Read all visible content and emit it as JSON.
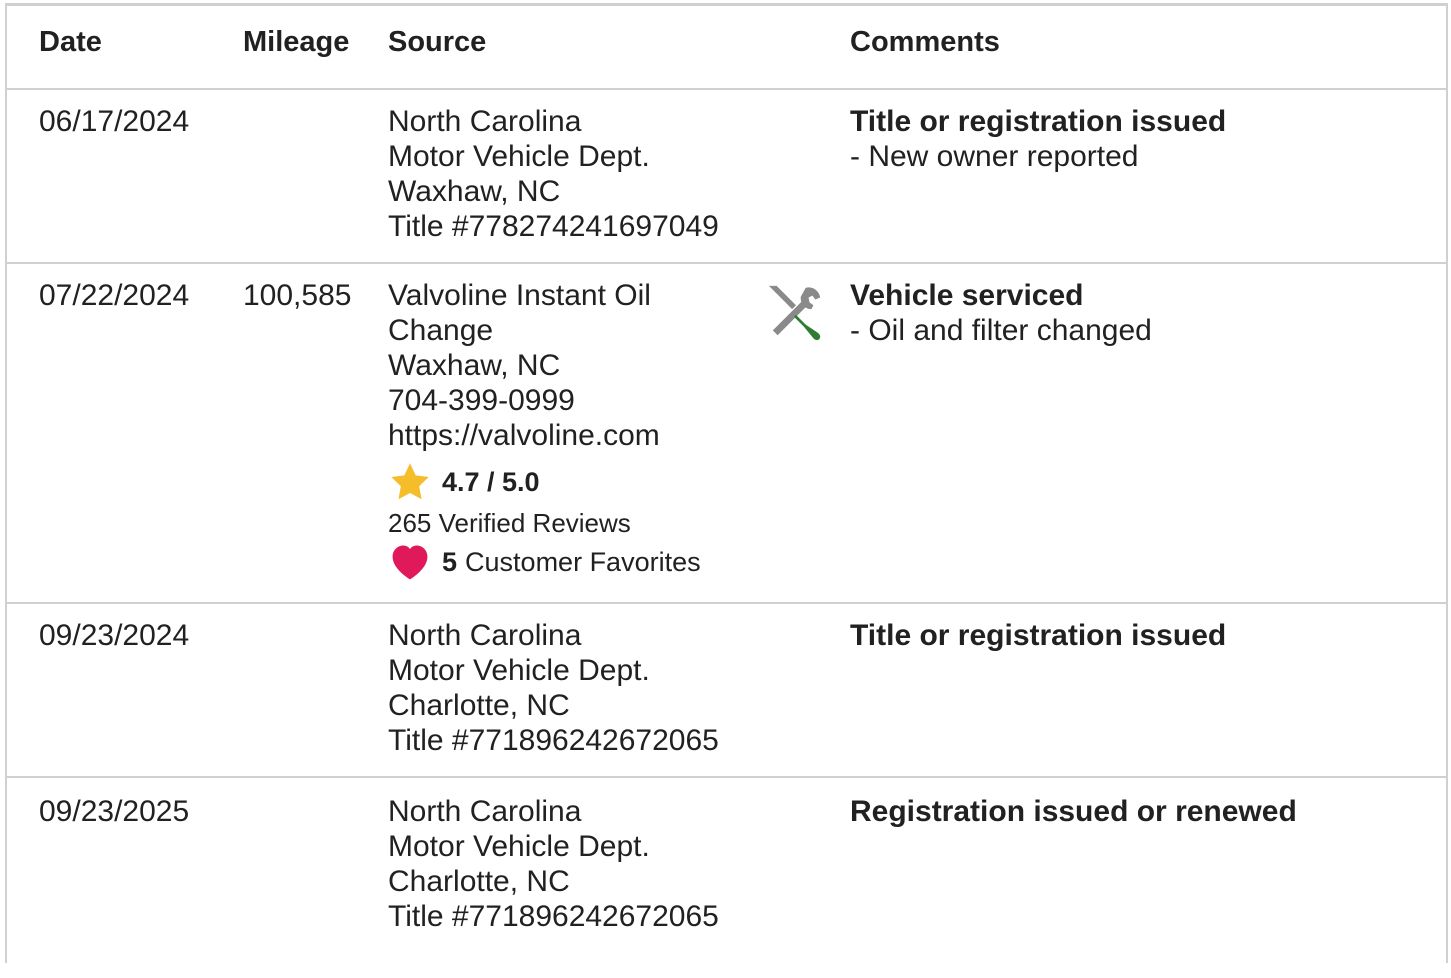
{
  "headers": {
    "date": "Date",
    "mileage": "Mileage",
    "source": "Source",
    "comments": "Comments"
  },
  "rows": [
    {
      "date": "06/17/2024",
      "mileage": "",
      "source": [
        "North Carolina",
        "Motor Vehicle Dept.",
        "Waxhaw, NC",
        "Title #778274241697049"
      ],
      "comment_title": "Title or registration issued",
      "comment_sub": "- New owner reported"
    },
    {
      "date": "07/22/2024",
      "mileage": "100,585",
      "source": [
        "Valvoline Instant Oil",
        "Change",
        "Waxhaw, NC",
        "704-399-0999",
        "https://valvoline.com"
      ],
      "icon": "wrench-screwdriver-icon",
      "rating": "4.7 / 5.0",
      "reviews": "265 Verified Reviews",
      "favorites_count": "5",
      "favorites_label": "Customer Favorites",
      "comment_title": "Vehicle serviced",
      "comment_sub": "- Oil and filter changed"
    },
    {
      "date": "09/23/2024",
      "mileage": "",
      "source": [
        "North Carolina",
        "Motor Vehicle Dept.",
        "Charlotte, NC",
        "Title #771896242672065"
      ],
      "comment_title": "Title or registration issued",
      "comment_sub": ""
    },
    {
      "date": "09/23/2025",
      "mileage": "",
      "source": [
        "North Carolina",
        "Motor Vehicle Dept.",
        "Charlotte, NC",
        "Title #771896242672065"
      ],
      "comment_title": "Registration issued or renewed",
      "comment_sub": ""
    }
  ],
  "colors": {
    "star": "#f6bd2a",
    "heart": "#e0195b",
    "screwdriver": "#2e7d32",
    "wrench": "#8a8a8a",
    "border": "#d0d0d0",
    "text": "#212121"
  }
}
